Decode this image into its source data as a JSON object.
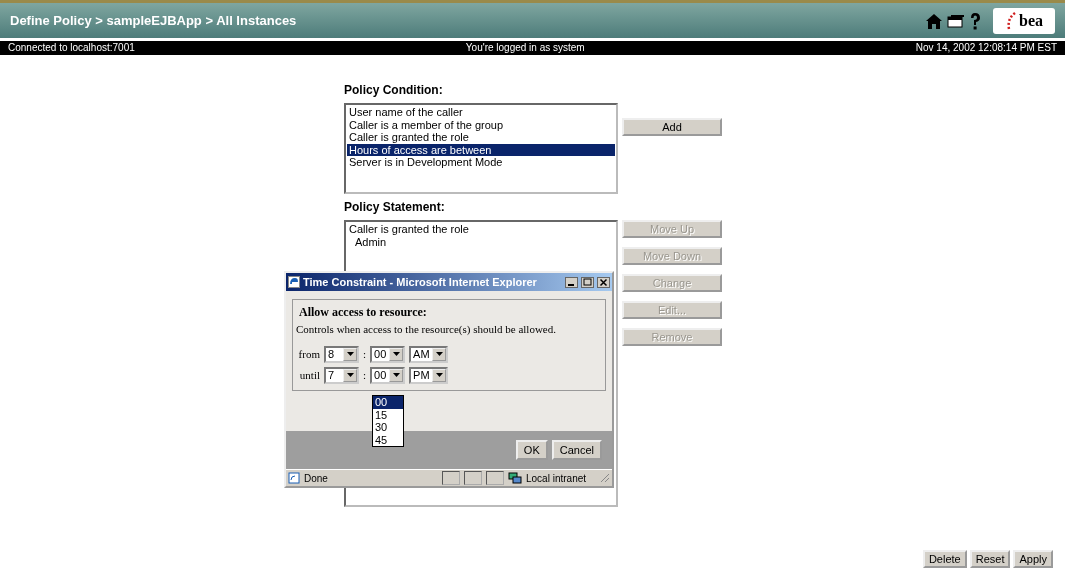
{
  "header": {
    "title": "Define Policy > sampleEJBApp > All Instances",
    "logo_text": "bea",
    "connection": "Connected to localhost:7001",
    "user": "You're logged in as system",
    "datetime": "Nov 14, 2002 12:08:14 PM EST"
  },
  "policy_condition": {
    "label": "Policy Condition:",
    "items": [
      {
        "text": "User name of the caller",
        "selected": false
      },
      {
        "text": "Caller is a member of the group",
        "selected": false
      },
      {
        "text": "Caller is granted the role",
        "selected": false
      },
      {
        "text": "Hours of access are between",
        "selected": true
      },
      {
        "text": "Server is in Development Mode",
        "selected": false
      }
    ],
    "add_button": {
      "label": "Add",
      "disabled": false
    }
  },
  "policy_statement": {
    "label": "Policy Statement:",
    "items": [
      {
        "text": "Caller is granted the role",
        "children": [
          {
            "text": "Admin"
          }
        ]
      }
    ]
  },
  "side_buttons": [
    {
      "label": "Move Up",
      "disabled": true
    },
    {
      "label": "Move Down",
      "disabled": true
    },
    {
      "label": "Change",
      "disabled": true
    },
    {
      "label": "Edit...",
      "disabled": true
    },
    {
      "label": "Remove",
      "disabled": true
    }
  ],
  "dialog": {
    "title": "Time Constraint - Microsoft Internet Explorer",
    "legend": "Allow access to resource:",
    "description": "Controls when access to the resource(s) should be allowed.",
    "rows": [
      {
        "label": "from",
        "hour": "8",
        "minute": "00",
        "period": "AM"
      },
      {
        "label": "until",
        "hour": "7",
        "minute": "00",
        "period": "PM"
      }
    ],
    "separator": ":",
    "open_list": {
      "options": [
        {
          "text": "00",
          "selected": true
        },
        {
          "text": "15",
          "selected": false
        },
        {
          "text": "30",
          "selected": false
        },
        {
          "text": "45",
          "selected": false
        }
      ]
    },
    "buttons": [
      "OK",
      "Cancel"
    ],
    "status": "Done",
    "zone": "Local intranet"
  },
  "footer_buttons": [
    "Delete",
    "Reset",
    "Apply"
  ]
}
